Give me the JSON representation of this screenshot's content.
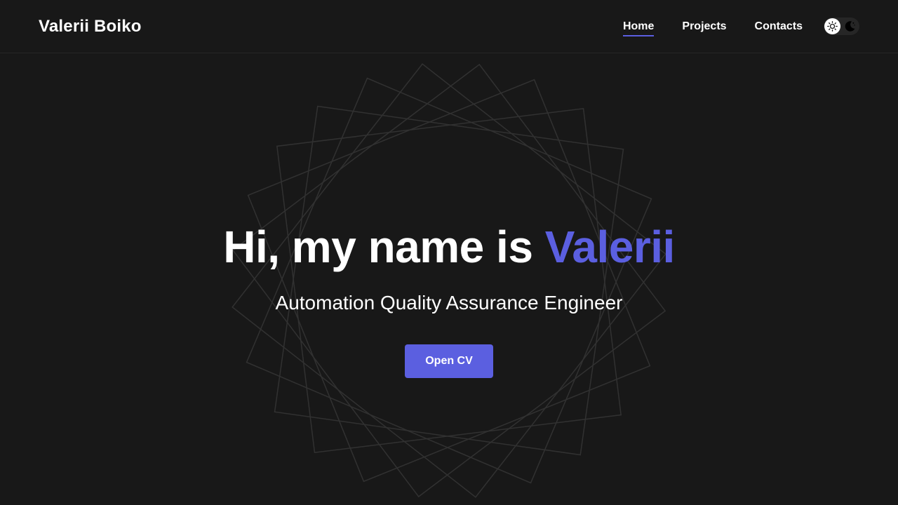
{
  "header": {
    "logo": "Valerii Boiko",
    "nav": [
      {
        "label": "Home",
        "active": true
      },
      {
        "label": "Projects",
        "active": false
      },
      {
        "label": "Contacts",
        "active": false
      }
    ],
    "theme_toggle": {
      "light_icon": "sun-icon",
      "dark_icon": "moon-icon",
      "selected": "light"
    }
  },
  "hero": {
    "title_prefix": "Hi, my name is ",
    "title_accent": "Valerii",
    "subtitle": "Automation Quality Assurance Engineer",
    "cta_label": "Open CV"
  },
  "colors": {
    "background": "#181818",
    "accent": "#5b5fe0",
    "text": "#ffffff",
    "decor_lines": "#3a3a3a"
  }
}
